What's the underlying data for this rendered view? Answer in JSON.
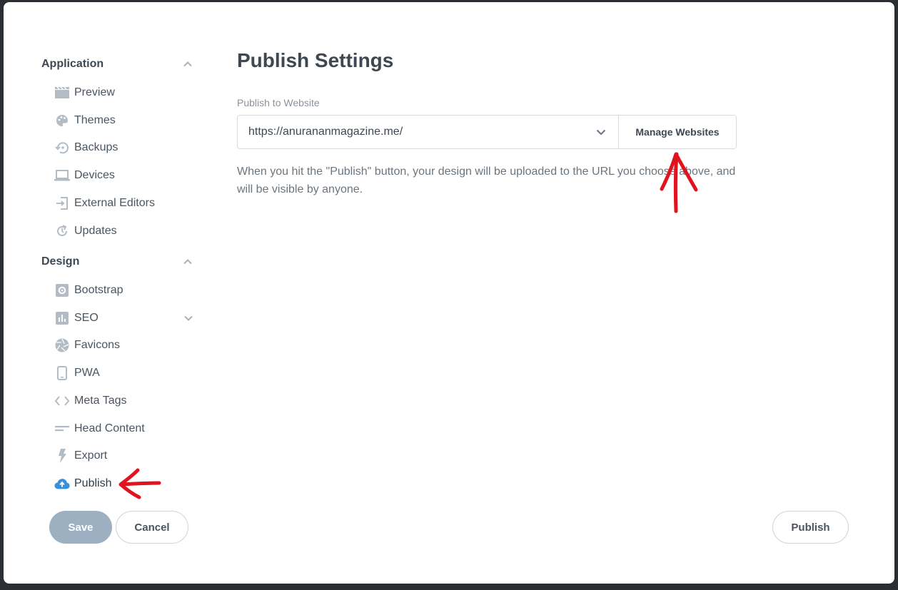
{
  "sidebar": {
    "sections": [
      {
        "title": "Application",
        "items": [
          {
            "label": "Preview",
            "icon": "clapperboard-icon"
          },
          {
            "label": "Themes",
            "icon": "palette-icon"
          },
          {
            "label": "Backups",
            "icon": "backup-restore-icon"
          },
          {
            "label": "Devices",
            "icon": "laptop-icon"
          },
          {
            "label": "External Editors",
            "icon": "external-editor-icon"
          },
          {
            "label": "Updates",
            "icon": "refresh-icon"
          }
        ]
      },
      {
        "title": "Design",
        "items": [
          {
            "label": "Bootstrap",
            "icon": "gear-icon"
          },
          {
            "label": "SEO",
            "icon": "bar-chart-icon"
          },
          {
            "label": "Favicons",
            "icon": "aperture-icon"
          },
          {
            "label": "PWA",
            "icon": "mobile-icon"
          },
          {
            "label": "Meta Tags",
            "icon": "code-icon"
          },
          {
            "label": "Head Content",
            "icon": "lines-icon"
          },
          {
            "label": "Export",
            "icon": "bolt-icon"
          },
          {
            "label": "Publish",
            "icon": "cloud-upload-icon"
          }
        ]
      }
    ]
  },
  "main": {
    "title": "Publish Settings",
    "field_label": "Publish to Website",
    "selected_url": "https://anurananmagazine.me/",
    "manage_button": "Manage Websites",
    "help_text": "When you hit the \"Publish\" button, your design will be uploaded to the URL you choose above, and will be visible by anyone."
  },
  "footer": {
    "save_label": "Save",
    "cancel_label": "Cancel",
    "publish_label": "Publish"
  },
  "colors": {
    "accent_blue": "#3a8fd9",
    "icon_gray": "#b3bcc5",
    "annotation_red": "#e0141e"
  }
}
